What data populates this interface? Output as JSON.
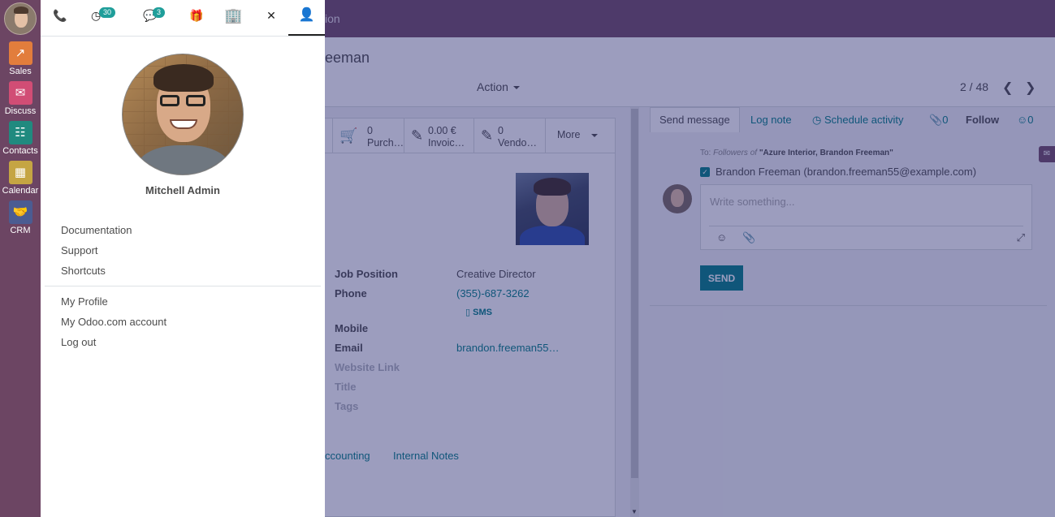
{
  "topbar": {
    "breadcrumb_fragment": "ion"
  },
  "control_panel": {
    "title_fragment": "eeman",
    "action_label": "Action",
    "pager": "2 / 48",
    "prev_icon": "chevron-left-icon",
    "next_icon": "chevron-right-icon"
  },
  "smart_buttons": [
    {
      "icon": "cart-icon",
      "value": "0",
      "label": "Purch…"
    },
    {
      "icon": "edit-icon",
      "value": "0.00 €",
      "label": "Invoic…"
    },
    {
      "icon": "edit-icon",
      "value": "0",
      "label": "Vendo…"
    },
    {
      "label": "More"
    }
  ],
  "contact": {
    "fields": [
      {
        "label": "Job Position",
        "value": "Creative Director"
      },
      {
        "label": "Phone",
        "value": "(355)-687-3262"
      },
      {
        "label": "Mobile",
        "value": ""
      },
      {
        "label": "Email",
        "value": "brandon.freeman55…"
      },
      {
        "label": "Website Link",
        "value": ""
      },
      {
        "label": "Title",
        "value": ""
      },
      {
        "label": "Tags",
        "value": ""
      }
    ],
    "sms_label": "SMS"
  },
  "notebook_tabs": {
    "accounting": "ccounting",
    "internal_notes": "Internal Notes"
  },
  "chatter": {
    "tabs": {
      "send_message": "Send message",
      "log_note": "Log note",
      "schedule_activity": "Schedule activity",
      "attachments_count": "0",
      "follow": "Follow",
      "followers_count": "0"
    },
    "to_prefix": "To:",
    "to_followers": "Followers of",
    "to_names": "\"Azure Interior, Brandon Freeman\"",
    "follower": "Brandon Freeman (brandon.freeman55@example.com)",
    "placeholder": "Write something...",
    "send_label": "SEND"
  },
  "appbar": {
    "apps": [
      {
        "name": "Sales",
        "color": "#e27d3c",
        "icon": "chart-icon"
      },
      {
        "name": "Discuss",
        "color": "#d14d75",
        "icon": "chat-bubble-icon"
      },
      {
        "name": "Contacts",
        "color": "#208a7f",
        "icon": "address-book-icon"
      },
      {
        "name": "Calendar",
        "color": "#c5a543",
        "icon": "calendar-icon"
      },
      {
        "name": "CRM",
        "color": "#4b5c92",
        "icon": "handshake-icon"
      }
    ]
  },
  "user_panel": {
    "systray": {
      "activities_badge": "30",
      "messages_badge": "3"
    },
    "user_name": "Mitchell Admin",
    "links_top": [
      "Documentation",
      "Support",
      "Shortcuts"
    ],
    "links_bottom": [
      "My Profile",
      "My Odoo.com account",
      "Log out"
    ]
  }
}
